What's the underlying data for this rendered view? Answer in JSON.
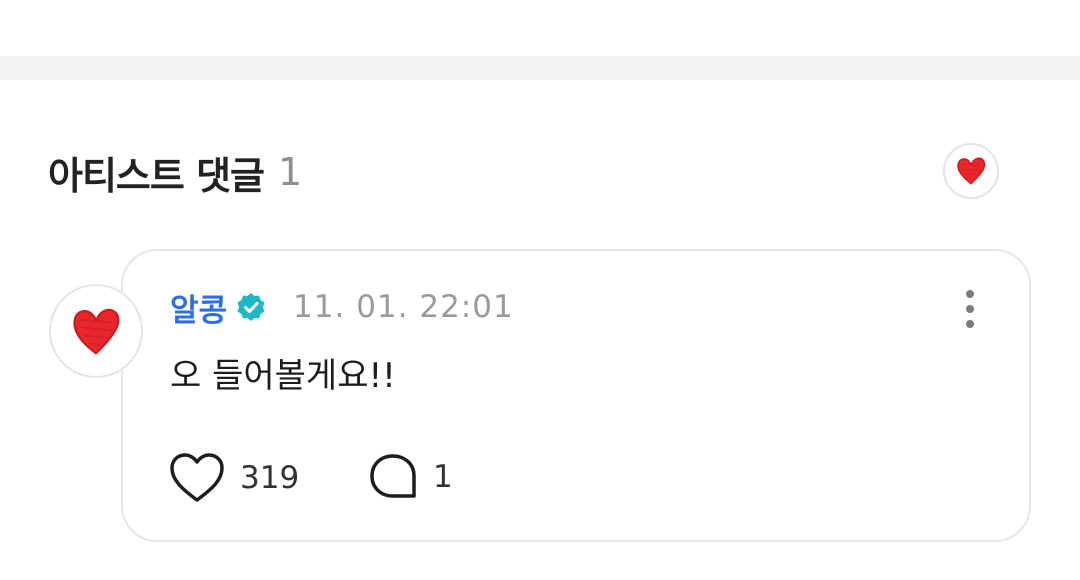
{
  "section": {
    "title": "아티스트 댓글",
    "count": "1"
  },
  "header_avatar": {
    "icon": "red-heart-icon"
  },
  "comment": {
    "avatar_icon": "red-heart-icon",
    "author": "알콩",
    "verified_icon": "verified-badge-icon",
    "verified_color": "#1fb8c9",
    "timestamp": "11. 01. 22:01",
    "text": "오 들어볼게요!!",
    "likes": "319",
    "replies": "1",
    "like_icon": "heart-outline-icon",
    "reply_icon": "speech-bubble-icon",
    "more_icon": "more-vertical-icon"
  },
  "colors": {
    "author": "#2f6fe0",
    "heart": "#e8262c",
    "divider": "#f3f3f3"
  }
}
